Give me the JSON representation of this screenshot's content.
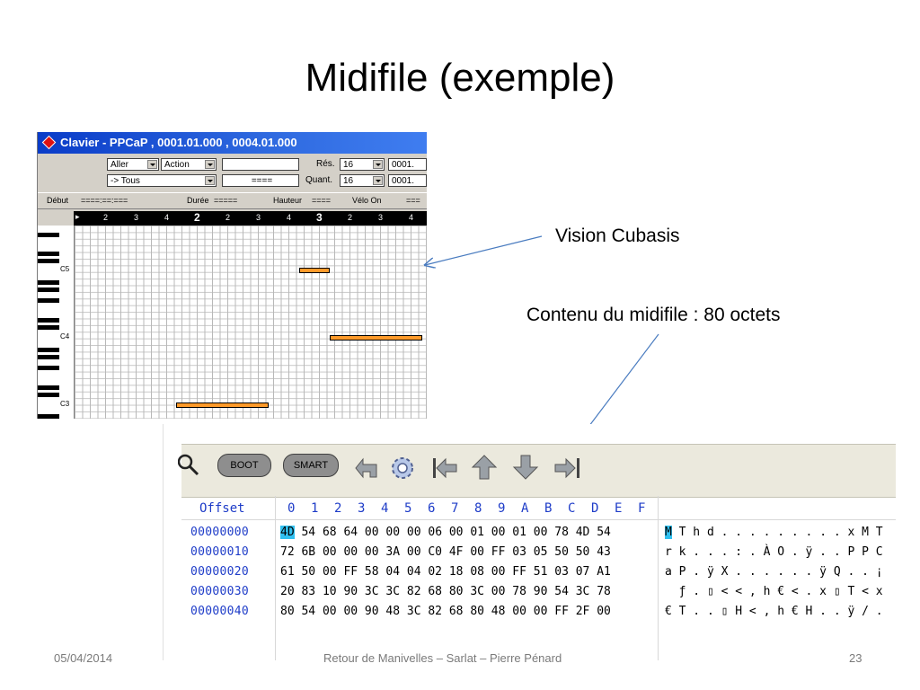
{
  "slide": {
    "title": "Midifile (exemple)",
    "annotation_cubasis": "Vision Cubasis",
    "annotation_midifile": "Contenu du midifile : 80 octets"
  },
  "cubasis": {
    "window_title": "Clavier - PPCaP , 0001.01.000 , 0004.01.000",
    "goto_combo": "Aller",
    "action_combo": "Action",
    "filter_combo": "-> Tous",
    "empty_field_1": "",
    "dashes_field": "====",
    "res_label": "Rés.",
    "res_value": "16",
    "res_pos": "0001.",
    "quant_label": "Quant.",
    "quant_value": "16",
    "quant_pos": "0001.",
    "info": {
      "debut_label": "Début",
      "debut_value": "====:==:===",
      "duree_label": "Durée",
      "duree_value": "=====",
      "hauteur_label": "Hauteur",
      "hauteur_value": "====",
      "velo_label": "Vélo On",
      "velo_value": "==="
    },
    "ruler": [
      "2",
      "3",
      "4",
      "2",
      "2",
      "3",
      "4",
      "3",
      "2",
      "3",
      "4"
    ],
    "key_labels": [
      "C5",
      "C4",
      "C3"
    ]
  },
  "hex_editor": {
    "toolbar": {
      "boot_label": "BOOT",
      "smart_label": "SMART"
    },
    "header_offset": "Offset",
    "header_columns": [
      "0",
      "1",
      "2",
      "3",
      "4",
      "5",
      "6",
      "7",
      "8",
      "9",
      "A",
      "B",
      "C",
      "D",
      "E",
      "F"
    ],
    "rows": [
      {
        "offset": "00000000",
        "first_byte": "4D",
        "bytes_rest": " 54 68 64 00 00 00 06 00 01 00 01 00 78 4D 54",
        "ascii_first": "M",
        "ascii_rest": "T h d . . . . . . . . . x M T"
      },
      {
        "offset": "00000010",
        "first_byte": "",
        "bytes_rest": "72 6B 00 00 00 3A 00 C0 4F 00 FF 03 05 50 50 43",
        "ascii_first": "",
        "ascii_rest": "r k . . . : . À O . ÿ . . P P C"
      },
      {
        "offset": "00000020",
        "first_byte": "",
        "bytes_rest": "61 50 00 FF 58 04 04 02 18 08 00 FF 51 03 07 A1",
        "ascii_first": "",
        "ascii_rest": "a P . ÿ X . . . . . . ÿ Q . . ¡"
      },
      {
        "offset": "00000030",
        "first_byte": "",
        "bytes_rest": "20 83 10 90 3C 3C 82 68 80 3C 00 78 90 54 3C 78",
        "ascii_first": "",
        "ascii_rest": "  ƒ . ▯ < < , h € < . x ▯ T < x"
      },
      {
        "offset": "00000040",
        "first_byte": "",
        "bytes_rest": "80 54 00 00 90 48 3C 82 68 80 48 00 00 FF 2F 00",
        "ascii_first": "",
        "ascii_rest": "€ T . . ▯ H < , h € H . . ÿ / ."
      }
    ]
  },
  "footer": {
    "date": "05/04/2014",
    "center": "Retour de Manivelles – Sarlat – Pierre Pénard",
    "page": "23"
  }
}
